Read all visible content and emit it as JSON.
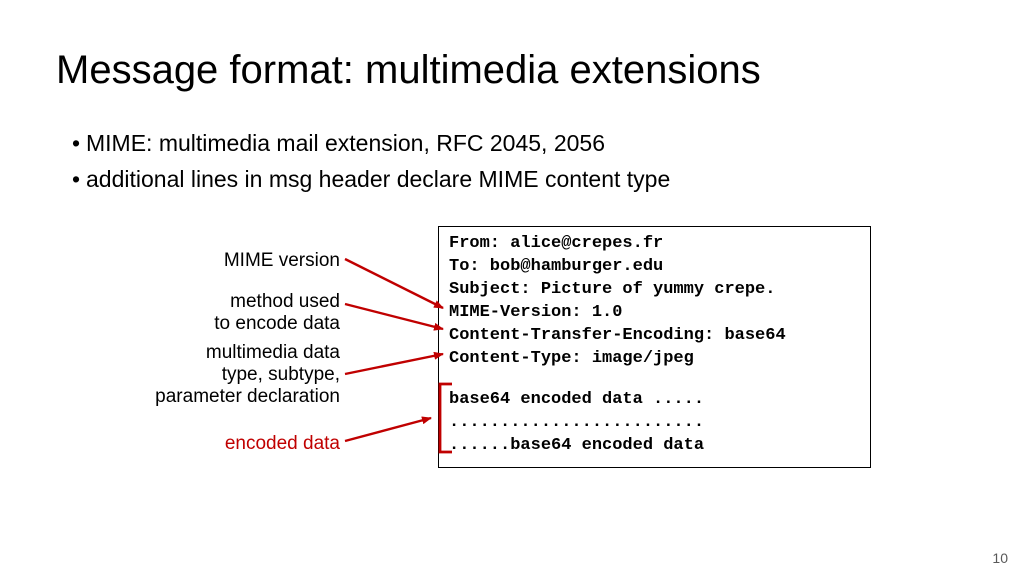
{
  "title": "Message format: multimedia extensions",
  "bullets": [
    "MIME: multimedia mail extension, RFC 2045, 2056",
    "additional lines in msg header declare MIME content type"
  ],
  "annotations": {
    "a1": "MIME version",
    "a2_line1": "method used",
    "a2_line2": "to encode data",
    "a3_line1": "multimedia data",
    "a3_line2": "type, subtype,",
    "a3_line3": "parameter declaration",
    "a4": "encoded data"
  },
  "message": {
    "l1": "From: alice@crepes.fr",
    "l2": "To: bob@hamburger.edu",
    "l3": "Subject: Picture of yummy crepe.",
    "l4": "MIME-Version: 1.0",
    "l5": "Content-Transfer-Encoding: base64",
    "l6": "Content-Type: image/jpeg",
    "l7": "base64 encoded data .....",
    "l8": ".........................",
    "l9": "......base64 encoded data"
  },
  "page_number": "10"
}
